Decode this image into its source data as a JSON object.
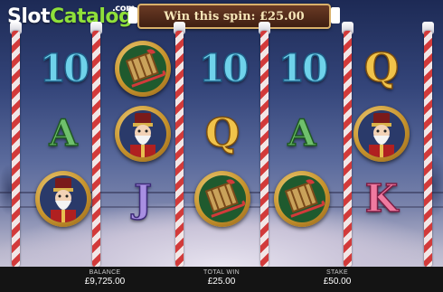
{
  "logo": {
    "part1": "Slot",
    "part2": "Catalog",
    "suffix": ".com"
  },
  "win_banner": {
    "text": "Win this spin: £25.00"
  },
  "reels": [
    [
      "10",
      "A",
      "nutcracker"
    ],
    [
      "sleigh",
      "nutcracker",
      "J"
    ],
    [
      "10",
      "Q",
      "sleigh"
    ],
    [
      "10",
      "A",
      "sleigh"
    ],
    [
      "Q",
      "nutcracker",
      "K"
    ]
  ],
  "symbol_styles": {
    "10": "t10",
    "Q": "tQ",
    "A": "tA",
    "J": "tJ",
    "K": "tK"
  },
  "bottom_bar": {
    "balance_label": "BALANCE",
    "balance_value": "£9,725.00",
    "total_win_label": "TOTAL WIN",
    "total_win_value": "£25.00",
    "stake_label": "STAKE",
    "stake_value": "£50.00"
  },
  "colors": {
    "accent_green": "#8fe03a",
    "banner_gold": "#d8b06a",
    "bar_bg": "#141414"
  }
}
